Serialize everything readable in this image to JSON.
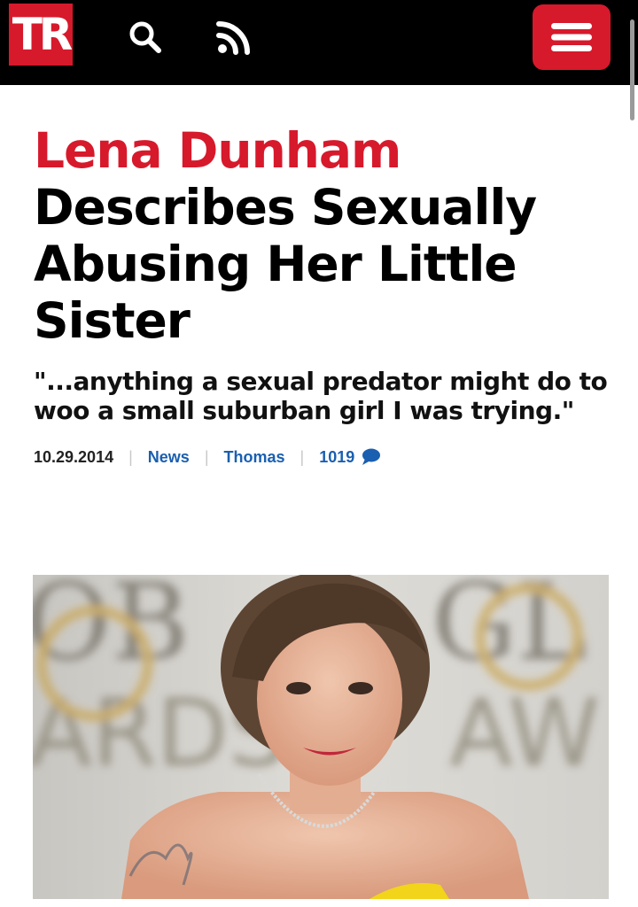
{
  "header": {
    "logo_text": "TR",
    "brand_color": "#d7192c",
    "icons": [
      "search-icon",
      "rss-icon",
      "menu-icon"
    ]
  },
  "article": {
    "headline_red": "Lena Dunham",
    "headline_rest": "Describes Sexually Abusing Her Little Sister",
    "subhead": "\"...anything a sexual predator might do to woo a small suburban girl I was trying.\"",
    "date": "10.29.2014",
    "category": "News",
    "author": "Thomas",
    "comment_count": "1019",
    "comment_icon": "speech-bubble-icon",
    "link_color": "#1a5fb0"
  },
  "image": {
    "backdrop_text": "GOLDEN GLOBE AWARDS",
    "backdrop_fragments": [
      "OB",
      "GL",
      "ARDS",
      "AW"
    ]
  }
}
